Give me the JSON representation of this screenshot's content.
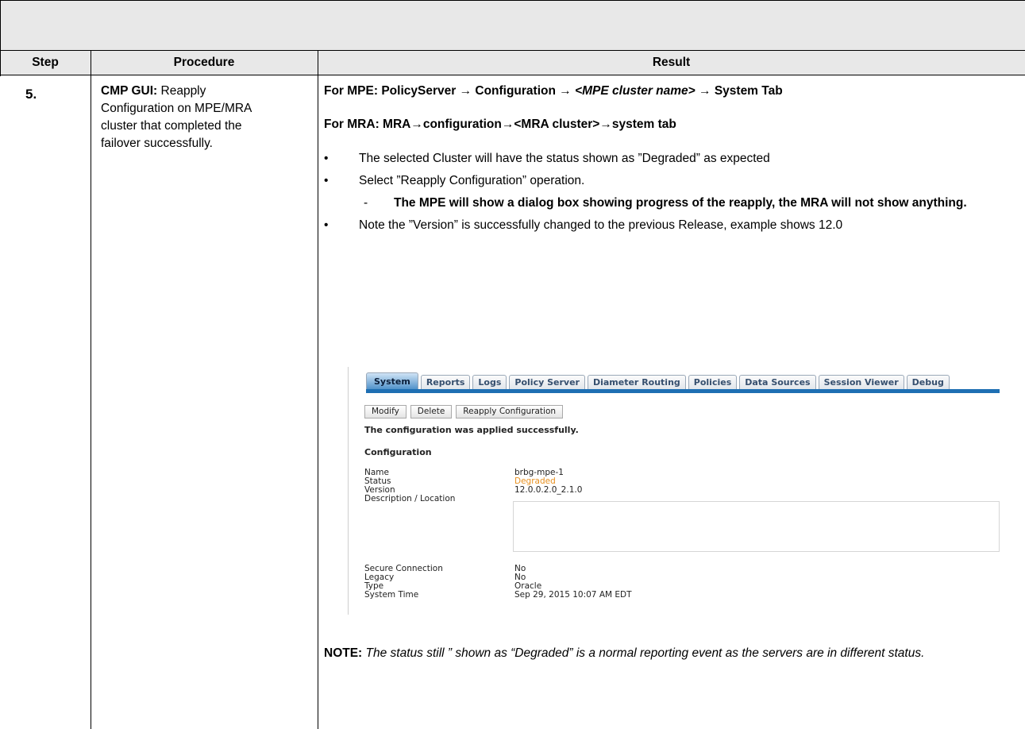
{
  "table": {
    "headers": [
      "Step",
      "Procedure",
      "Result"
    ]
  },
  "row": {
    "step": "5.",
    "procedure_bold": "CMP GUI:",
    "procedure_text": " Reapply Configuration on MPE/MRA cluster that completed the failover successfully."
  },
  "result": {
    "mpe_path_prefix": "For MPE: PolicyServer ",
    "mpe_path_mid": " Configuration ",
    "mpe_path_italic": " <MPE cluster name> ",
    "mpe_path_suffix": " System Tab",
    "mra_path_a": "For MRA: MRA",
    "mra_path_b": "configuration",
    "mra_path_c": "<MRA cluster>",
    "mra_path_d": "system tab",
    "bullets": [
      "The selected Cluster will have the status shown as ”Degraded” as expected",
      "Select ”Reapply Configuration” operation.",
      "Note the ”Version” is successfully changed to the previous Release, example shows 12.0"
    ],
    "sub_bullet": "The MPE will show a dialog box showing progress of the reapply, the MRA will not show anything."
  },
  "screenshot": {
    "tabs": [
      "System",
      "Reports",
      "Logs",
      "Policy Server",
      "Diameter Routing",
      "Policies",
      "Data Sources",
      "Session Viewer",
      "Debug"
    ],
    "buttons": [
      "Modify",
      "Delete",
      "Reapply Configuration"
    ],
    "message": "The configuration was applied successfully.",
    "section_title": "Configuration",
    "fields": {
      "name_label": "Name",
      "name_value": "brbg-mpe-1",
      "status_label": "Status",
      "status_value": "Degraded",
      "version_label": "Version",
      "version_value": "12.0.0.2.0_2.1.0",
      "desc_label": "Description / Location",
      "secure_label": "Secure Connection",
      "secure_value": "No",
      "legacy_label": "Legacy",
      "legacy_value": "No",
      "type_label": "Type",
      "type_value": "Oracle",
      "time_label": "System Time",
      "time_value": "Sep 29, 2015 10:07 AM EDT"
    },
    "colors": {
      "status_degraded": "#e8901e",
      "tab_bar": "#1e6fb3"
    }
  },
  "note": {
    "label": "NOTE:",
    "text": " The status still ” shown as “Degraded” is a normal reporting event as the servers are in different status."
  }
}
